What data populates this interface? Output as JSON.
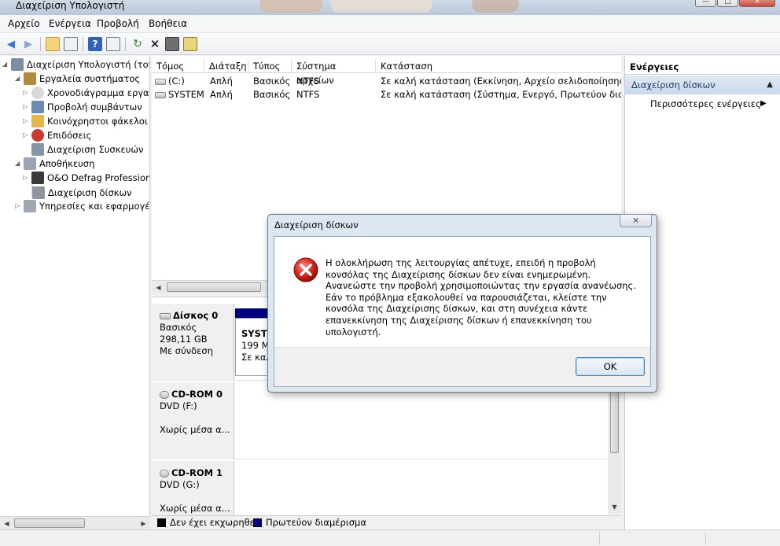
{
  "window": {
    "title": "Διαχείριση Υπολογιστή",
    "controls": [
      "—",
      "□",
      "✕"
    ]
  },
  "menu": [
    "Αρχείο",
    "Ενέργεια",
    "Προβολή",
    "Βοήθεια"
  ],
  "toolbar_icons": [
    "back-icon",
    "forward-icon",
    "up-folder-icon",
    "show-hide-tree-icon",
    "help-icon",
    "properties-pane-icon",
    "refresh-icon",
    "delete-icon",
    "properties-icon",
    "export-icon"
  ],
  "tree": {
    "items": [
      {
        "label": "Διαχείριση Υπολογιστή (τοπικός)",
        "icon": "computer-management-icon",
        "level": 0,
        "expander": "◢"
      },
      {
        "label": "Εργαλεία συστήματος",
        "icon": "tools-icon",
        "level": 1,
        "expander": "◢"
      },
      {
        "label": "Χρονοδιάγραμμα εργασιών",
        "icon": "clock-icon",
        "level": 2,
        "expander": "▷"
      },
      {
        "label": "Προβολή συμβάντων",
        "icon": "event-viewer-icon",
        "level": 2,
        "expander": "▷"
      },
      {
        "label": "Κοινόχρηστοι φάκελοι",
        "icon": "shared-folder-icon",
        "level": 2,
        "expander": "▷"
      },
      {
        "label": "Επιδόσεις",
        "icon": "performance-icon",
        "level": 2,
        "expander": "▷"
      },
      {
        "label": "Διαχείριση Συσκευών",
        "icon": "device-manager-icon",
        "level": 2,
        "expander": ""
      },
      {
        "label": "Αποθήκευση",
        "icon": "storage-icon",
        "level": 1,
        "expander": "◢"
      },
      {
        "label": "O&O Defrag Professional",
        "icon": "defrag-icon",
        "level": 2,
        "expander": "▷"
      },
      {
        "label": "Διαχείριση δίσκων",
        "icon": "disk-management-icon",
        "level": 2,
        "expander": "",
        "selected": true
      },
      {
        "label": "Υπηρεσίες και εφαρμογές",
        "icon": "services-icon",
        "level": 1,
        "expander": "▷"
      }
    ]
  },
  "volume_list": {
    "columns": [
      "Τόμος",
      "Διάταξη",
      "Τύπος",
      "Σύστημα αρχείων",
      "Κατάσταση"
    ],
    "rows": [
      {
        "volume": "(C:)",
        "layout": "Απλή",
        "type": "Βασικός",
        "fs": "NTFS",
        "status": "Σε καλή κατάσταση (Εκκίνηση, Αρχείο σελιδοποίησης, Απ"
      },
      {
        "volume": "SYSTEM",
        "layout": "Απλή",
        "type": "Βασικός",
        "fs": "NTFS",
        "status": "Σε καλή κατάσταση (Σύστημα, Ενεργό, Πρωτεύον διαμέρ"
      }
    ]
  },
  "disks": [
    {
      "name": "Δίσκος 0",
      "line2": "Βασικός",
      "line3": "298,11 GB",
      "line4": "Με σύνδεση",
      "icon": "hdd-icon"
    },
    {
      "name": "CD-ROM 0",
      "line2": "DVD (F:)",
      "line3": "",
      "line4": "Χωρίς μέσα α...",
      "icon": "cdrom-icon"
    },
    {
      "name": "CD-ROM 1",
      "line2": "DVD (G:)",
      "line3": "",
      "line4": "Χωρίς μέσα α...",
      "icon": "cdrom-icon"
    }
  ],
  "partition": {
    "name": "SYSTE",
    "size": "199 M",
    "status": "Σε καλ"
  },
  "legend": {
    "unallocated": "Δεν έχει εκχωρηθεί",
    "primary": "Πρωτεύον διαμέρισμα",
    "unallocated_color": "#000000",
    "primary_color": "#00007f"
  },
  "actions": {
    "header": "Ενέργειες",
    "section": "Διαχείριση δίσκων",
    "more": "Περισσότερες ενέργειες"
  },
  "dialog": {
    "title": "Διαχείριση δίσκων",
    "close": "✕",
    "message": "Η ολοκλήρωση της λειτουργίας απέτυχε, επειδή η προβολή κονσόλας της Διαχείρισης δίσκων δεν είναι ενημερωμένη. Ανανεώστε την προβολή χρησιμοποιώντας την εργασία ανανέωσης. Εάν το πρόβλημα εξακολουθεί να παρουσιάζεται, κλείστε την κονσόλα της Διαχείρισης δίσκων, και στη συνέχεια κάντε επανεκκίνηση της Διαχείρισης δίσκων ή επανεκκίνηση του υπολογιστή.",
    "ok": "OK",
    "icon": "error-icon"
  }
}
